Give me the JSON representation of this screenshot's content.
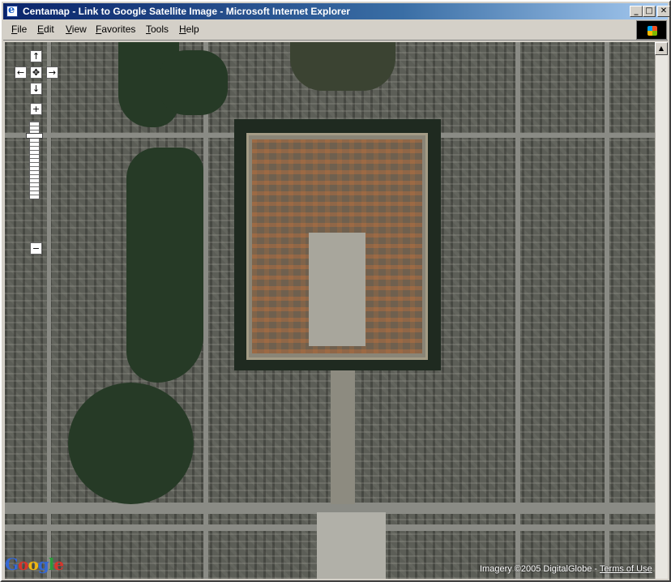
{
  "window": {
    "title": "Centamap - Link to Google Satellite Image - Microsoft Internet Explorer",
    "minimize_label": "_",
    "maximize_label": "□",
    "close_label": "✕"
  },
  "menu": {
    "items": [
      {
        "label": "File"
      },
      {
        "label": "Edit"
      },
      {
        "label": "View"
      },
      {
        "label": "Favorites"
      },
      {
        "label": "Tools"
      },
      {
        "label": "Help"
      }
    ]
  },
  "map": {
    "type": "satellite",
    "controls": {
      "pan_up": "↑",
      "pan_left": "←",
      "pan_center": "✥",
      "pan_right": "→",
      "pan_down": "↓",
      "zoom_in": "+",
      "zoom_out": "−"
    },
    "logo_letters": [
      "G",
      "o",
      "o",
      "g",
      "l",
      "e"
    ],
    "attribution_prefix": "Imagery ©2005 DigitalGlobe - ",
    "terms_link": "Terms of Use"
  },
  "scrollbar": {
    "up_arrow": "▲"
  },
  "colors": {
    "titlebar_start": "#0a246a",
    "titlebar_end": "#a6caf0",
    "chrome": "#d4d0c8"
  }
}
